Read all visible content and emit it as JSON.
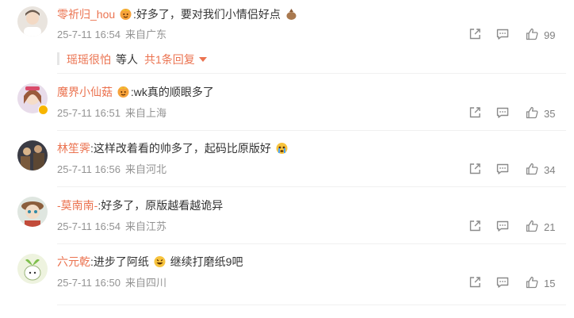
{
  "colors": {
    "username": "#eb7350",
    "meta": "#939393",
    "text": "#333333",
    "badge": "#f7b500"
  },
  "comments": [
    {
      "username": "零祈归_hou",
      "sep": ":",
      "text": "好多了，要对我们小情侣好点",
      "date": "25-7-11 16:54",
      "location": "来自广东",
      "likes": "99",
      "reply_summary": {
        "user": "瑶瑶很怕",
        "etc": "等人",
        "count": "共1条回复"
      }
    },
    {
      "username": "魔界小仙菇",
      "sep": ":",
      "text": "wk真的顺眼多了",
      "date": "25-7-11 16:51",
      "location": "来自上海",
      "likes": "35"
    },
    {
      "username": "林笙霁",
      "sep": ":",
      "text": "这样改着看的帅多了，起码比原版好",
      "date": "25-7-11 16:56",
      "location": "来自河北",
      "likes": "34"
    },
    {
      "username": "-莫南南-",
      "sep": ":",
      "text": "好多了，原版越看越诡异",
      "date": "25-7-11 16:54",
      "location": "来自江苏",
      "likes": "21"
    },
    {
      "username": "六元乾",
      "sep": ":",
      "text": "进步了阿纸",
      "text2": " 继续打磨纸9吧",
      "date": "25-7-11 16:50",
      "location": "来自四川",
      "likes": "15"
    }
  ],
  "icons": [
    "share-icon",
    "comment-icon",
    "like-icon",
    "fan-badge-icon",
    "verified-badge-icon"
  ]
}
